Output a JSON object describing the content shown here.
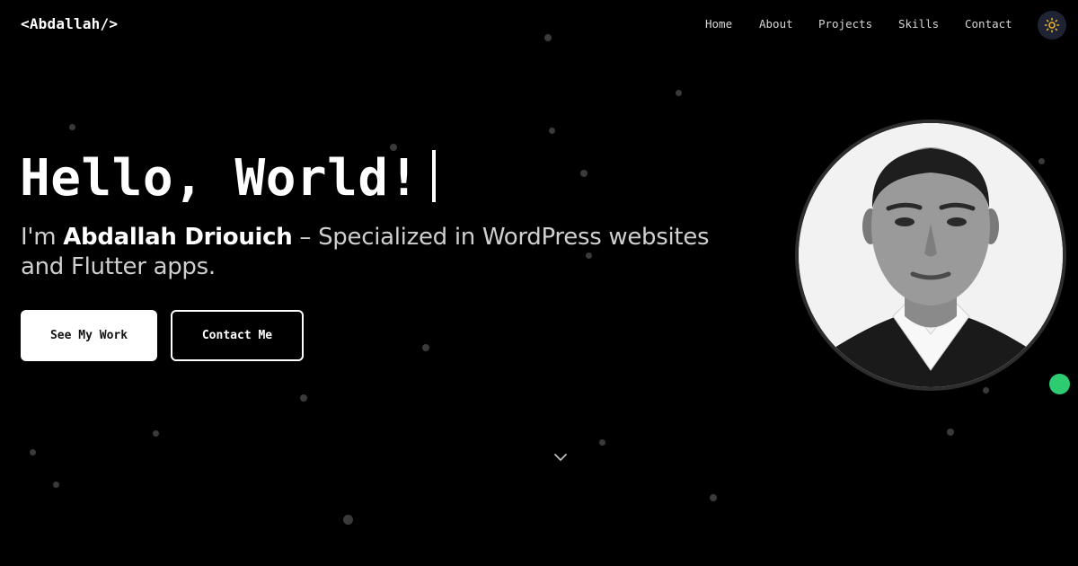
{
  "nav": {
    "logo": "<Abdallah/>",
    "links": [
      {
        "label": "Home"
      },
      {
        "label": "About"
      },
      {
        "label": "Projects"
      },
      {
        "label": "Skills"
      },
      {
        "label": "Contact"
      }
    ],
    "theme_toggle_icon": "sun-icon"
  },
  "hero": {
    "title": "Hello, World!",
    "subtitle_prefix": "I'm ",
    "name": "Abdallah Driouich",
    "subtitle_suffix": " – Specialized in WordPress websites and Flutter apps.",
    "primary_button": "See My Work",
    "secondary_button": "Contact Me",
    "scroll_icon": "chevron-down-icon"
  },
  "profile": {
    "photo": "profile-photo",
    "status": "online",
    "status_color": "#2ecc71"
  },
  "colors": {
    "background": "#000000",
    "text": "#ffffff",
    "accent_sun": "#f5b82e"
  }
}
